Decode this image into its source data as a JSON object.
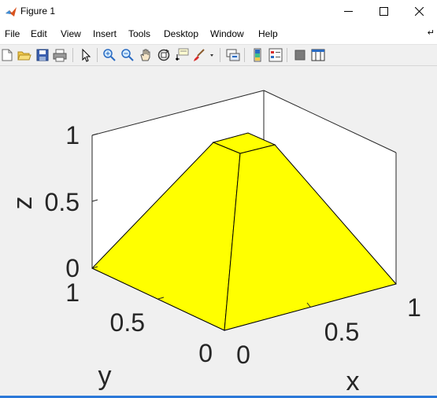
{
  "window": {
    "title": "Figure 1",
    "minimize_icon": "minimize-icon",
    "maximize_icon": "maximize-icon",
    "close_icon": "close-icon"
  },
  "menu": [
    "File",
    "Edit",
    "View",
    "Insert",
    "Tools",
    "Desktop",
    "Window",
    "Help"
  ],
  "toolbar": [
    "new-figure-icon",
    "open-file-icon",
    "save-icon",
    "print-icon",
    "select-arrow-icon",
    "zoom-in-icon",
    "zoom-out-icon",
    "pan-hand-icon",
    "rotate-3d-icon",
    "data-cursor-icon",
    "brush-icon",
    "link-plot-icon",
    "colorbar-icon",
    "legend-icon",
    "hide-plot-tools-icon",
    "show-plot-tools-icon"
  ],
  "axes": {
    "z_label": "z",
    "y_label": "y",
    "x_label": "x",
    "z_ticks": [
      "0",
      "0.5",
      "1"
    ],
    "y_ticks": [
      "0",
      "0.5",
      "1"
    ],
    "x_ticks": [
      "0",
      "0.5",
      "1"
    ]
  },
  "colors": {
    "surface": "#ffff00",
    "figure_bg": "#f0f0f0",
    "accent": "#2b78d8"
  }
}
